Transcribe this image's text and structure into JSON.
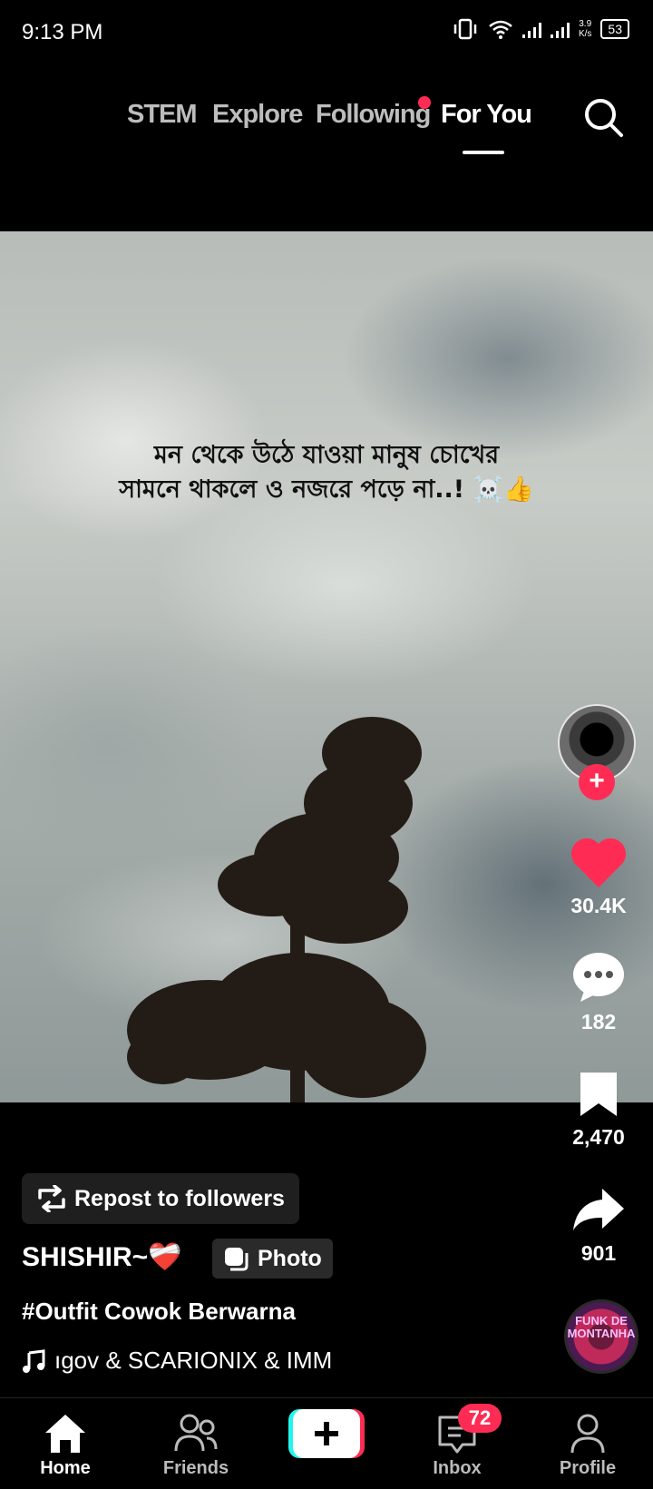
{
  "status_bar": {
    "time": "9:13 PM",
    "net_speed_value": "3.9",
    "net_speed_unit": "K/s",
    "battery": "53"
  },
  "top_tabs": [
    {
      "label": "STEM",
      "active": false
    },
    {
      "label": "Explore",
      "active": false
    },
    {
      "label": "Following",
      "active": false,
      "has_dot": true
    },
    {
      "label": "For You",
      "active": true
    }
  ],
  "video": {
    "caption_line1": "মন থেকে উঠে যাওয়া মানুষ চোখের",
    "caption_line2": "সামনে থাকলে ও নজরে পড়ে না..! ☠️👍"
  },
  "actions": {
    "likes": "30.4K",
    "comments": "182",
    "saves": "2,470",
    "shares": "901",
    "music_disc_text": "FUNK DE MONTANHA"
  },
  "post": {
    "repost_label": "Repost to followers",
    "username": "SHISHIR~❤️‍🩹",
    "type_label": "Photo",
    "hashtag": "#Outfit Cowok Berwarna",
    "music": "ıgov & SCARIONIX & IMM"
  },
  "bottom_nav": {
    "home": "Home",
    "friends": "Friends",
    "inbox": "Inbox",
    "inbox_badge": "72",
    "profile": "Profile"
  },
  "colors": {
    "accent": "#fe2c55",
    "background": "#000000",
    "inactive_tab": "#bdbdbd"
  }
}
